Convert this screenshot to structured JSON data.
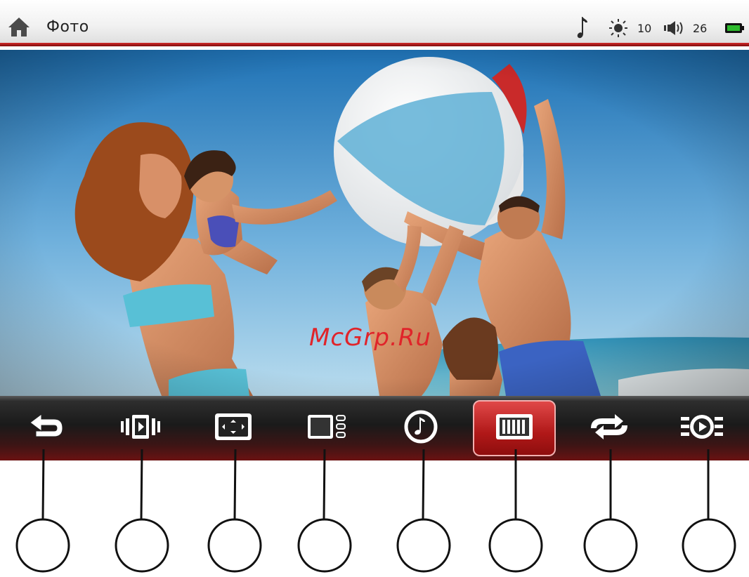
{
  "statusbar": {
    "title": "Фото",
    "home_icon": "home-icon",
    "music_icon": "music-note-icon",
    "brightness_value": "10",
    "volume_value": "26",
    "battery_color": "#2dbb2d",
    "accent_color": "#c41e1e"
  },
  "photo": {
    "description_icon": "photo-image",
    "watermark": "McGrp.Ru"
  },
  "toolbar": {
    "buttons": [
      {
        "name": "back-button",
        "icon": "back-arrow-icon"
      },
      {
        "name": "slideshow-button",
        "icon": "slideshow-icon"
      },
      {
        "name": "zoom-button",
        "icon": "zoom-fit-icon"
      },
      {
        "name": "thumbnail-button",
        "icon": "thumbnail-list-icon"
      },
      {
        "name": "music-button",
        "icon": "music-icon"
      },
      {
        "name": "filmstrip-button",
        "icon": "filmstrip-icon",
        "active": true
      },
      {
        "name": "repeat-button",
        "icon": "repeat-icon"
      },
      {
        "name": "play-effect-button",
        "icon": "play-effect-icon"
      }
    ]
  }
}
